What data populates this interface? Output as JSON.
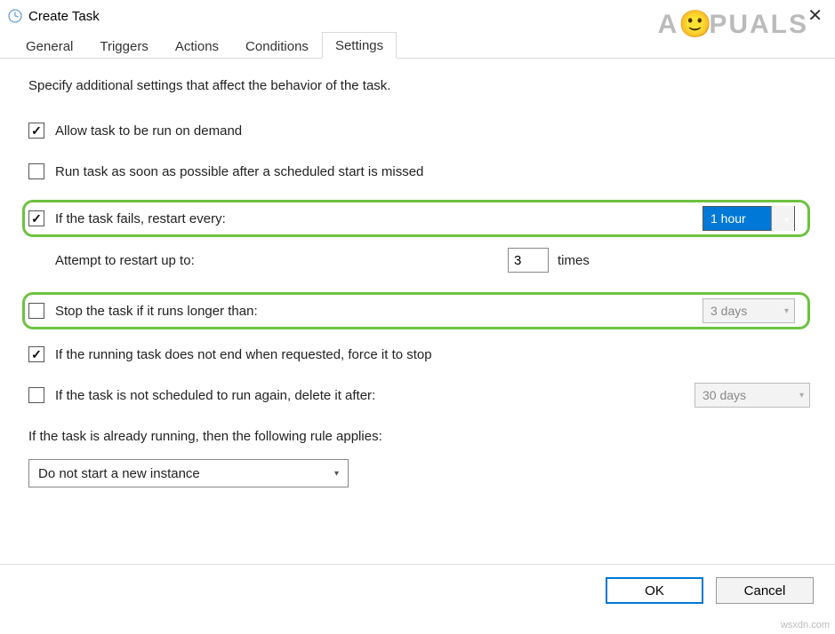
{
  "window": {
    "title": "Create Task"
  },
  "watermark": {
    "text1": "A",
    "text2": "PUALS",
    "url": "wsxdn.com"
  },
  "tabs": {
    "general": "General",
    "triggers": "Triggers",
    "actions": "Actions",
    "conditions": "Conditions",
    "settings": "Settings"
  },
  "settings": {
    "description": "Specify additional settings that affect the behavior of the task.",
    "allow_on_demand": "Allow task to be run on demand",
    "run_asap": "Run task as soon as possible after a scheduled start is missed",
    "restart_label": "If the task fails, restart every:",
    "restart_value": "1 hour",
    "attempt_label": "Attempt to restart up to:",
    "attempt_value": "3",
    "attempt_suffix": "times",
    "stop_if_longer": "Stop the task if it runs longer than:",
    "stop_if_longer_value": "3 days",
    "force_stop": "If the running task does not end when requested, force it to stop",
    "delete_after": "If the task is not scheduled to run again, delete it after:",
    "delete_after_value": "30 days",
    "rule_intro": "If the task is already running, then the following rule applies:",
    "rule_value": "Do not start a new instance"
  },
  "buttons": {
    "ok": "OK",
    "cancel": "Cancel"
  }
}
